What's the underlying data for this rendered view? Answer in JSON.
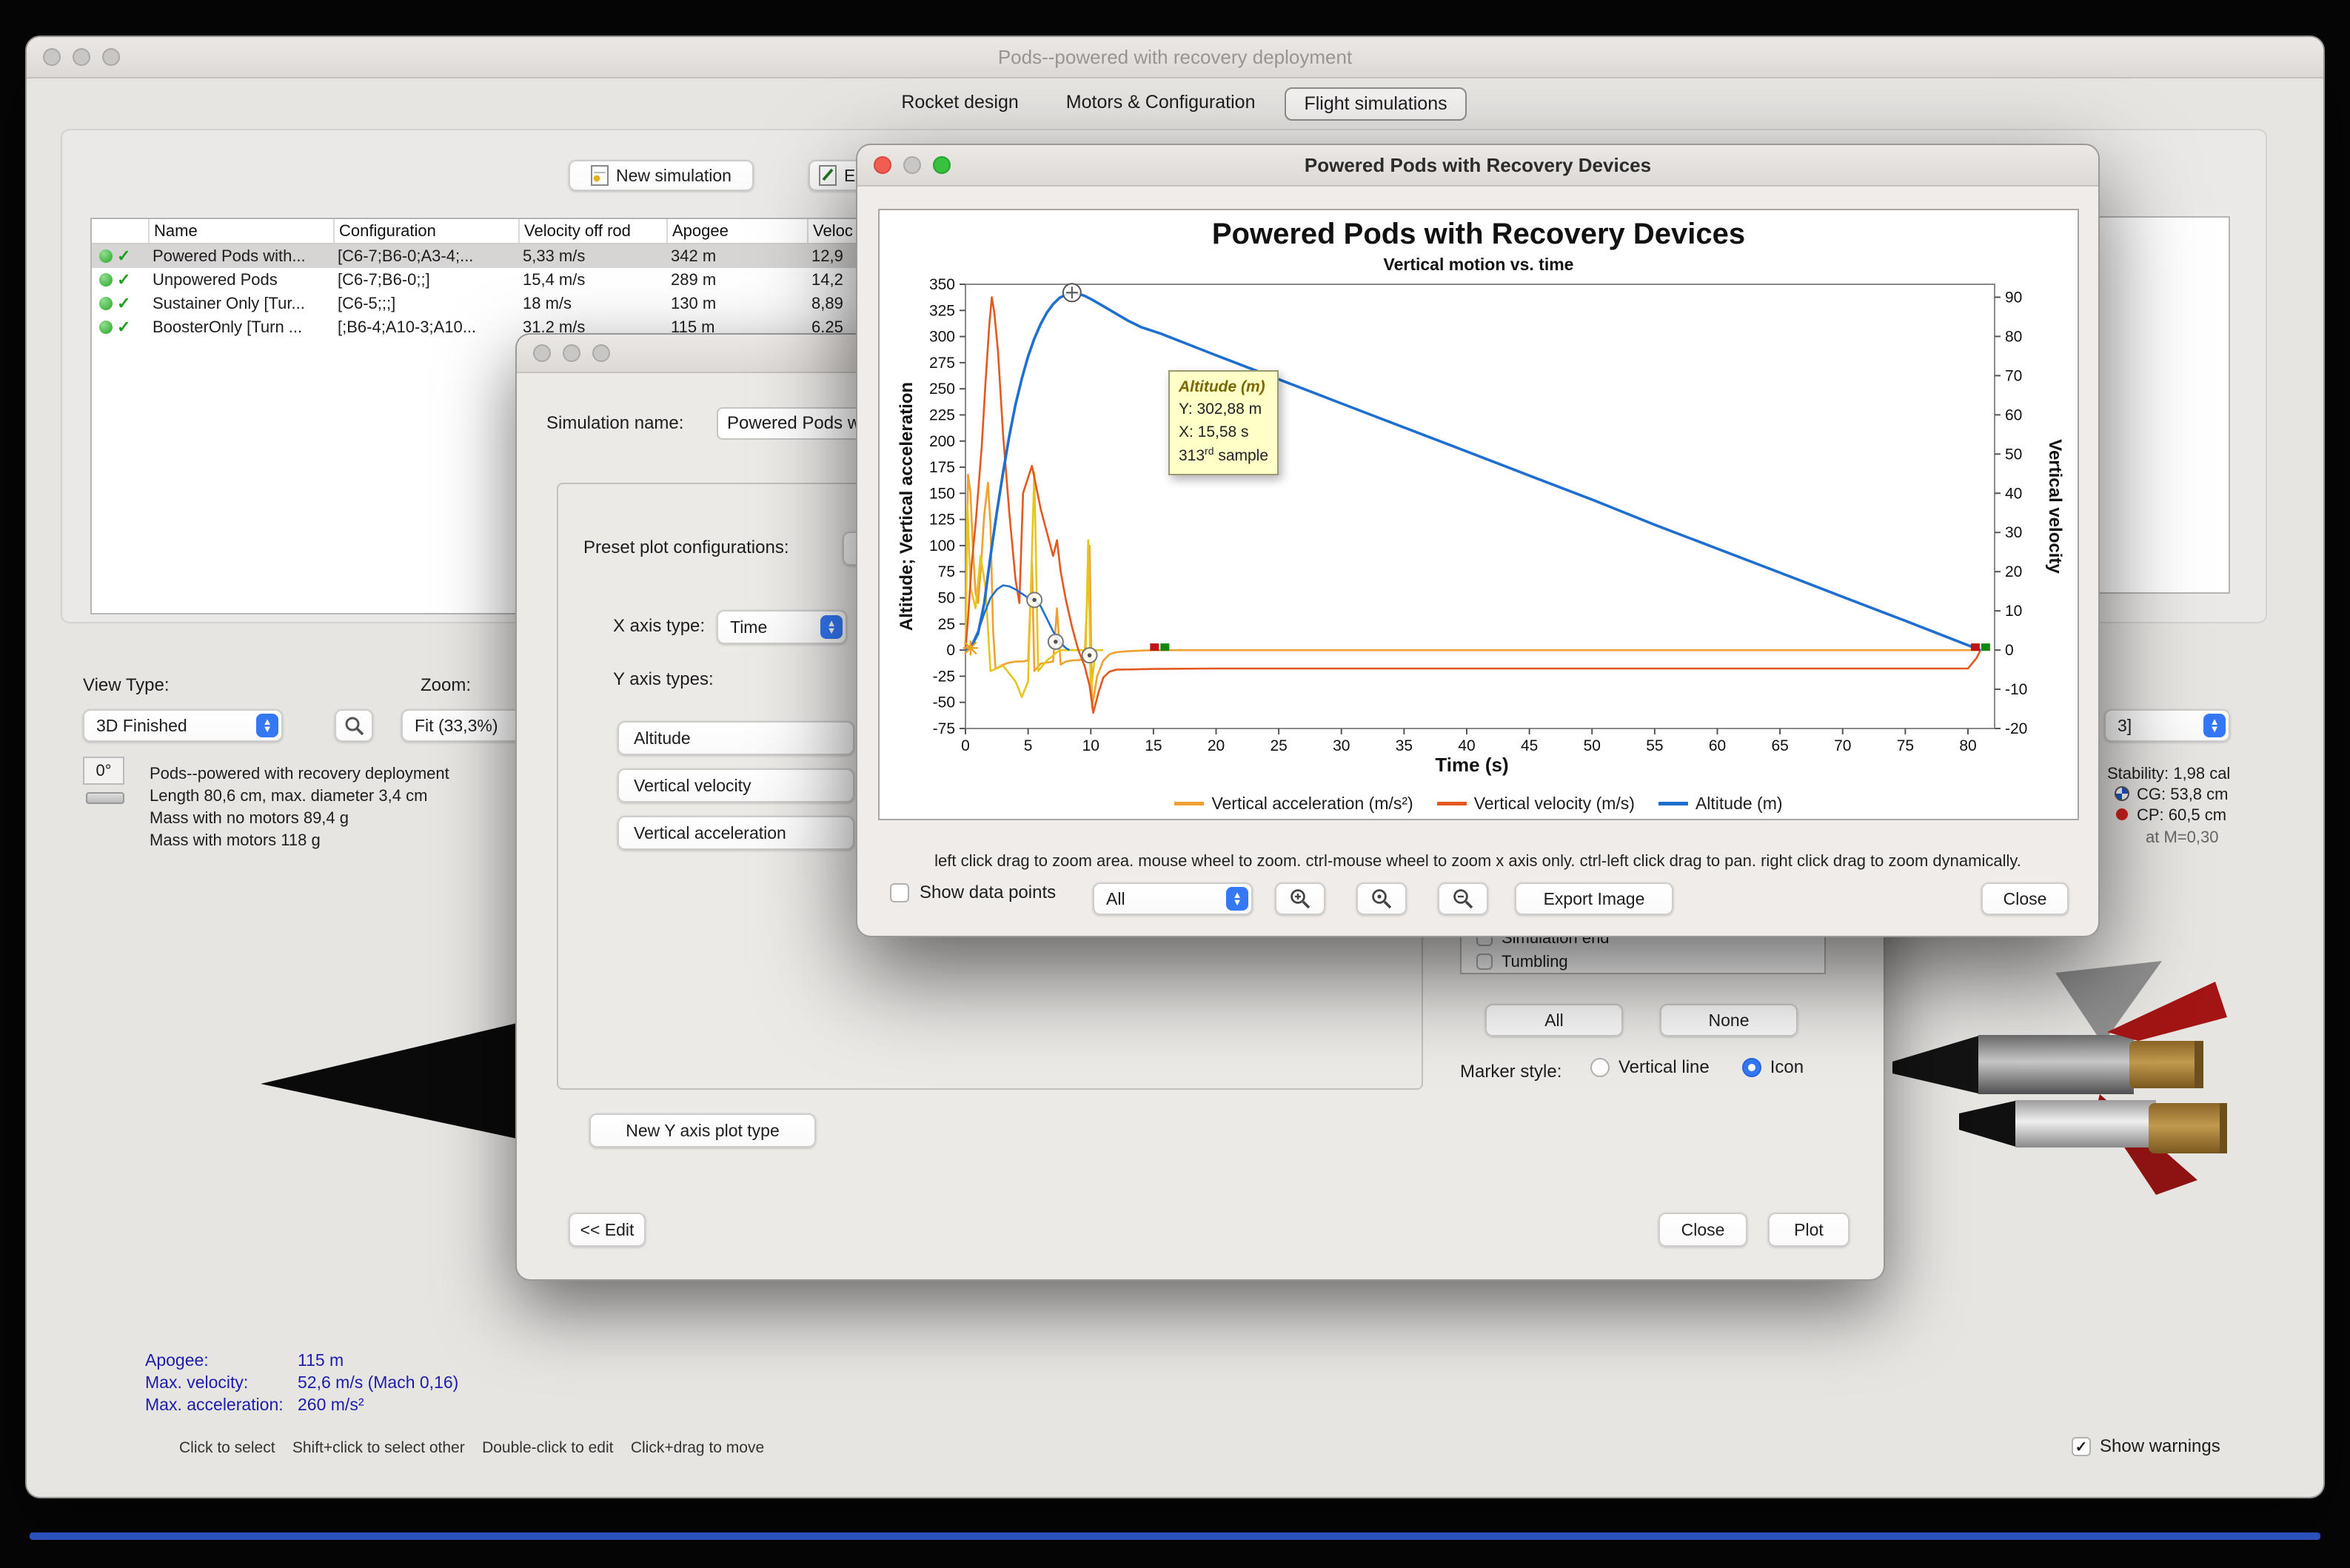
{
  "window": {
    "title": "Pods--powered with recovery deployment"
  },
  "tabs": [
    {
      "label": "Rocket design",
      "selected": false
    },
    {
      "label": "Motors & Configuration",
      "selected": false
    },
    {
      "label": "Flight simulations",
      "selected": true
    }
  ],
  "toolbar": {
    "new_simulation": "New simulation",
    "edit_partial": "E"
  },
  "sim_table": {
    "columns": [
      "Name",
      "Configuration",
      "Velocity off rod",
      "Apogee",
      "Veloc"
    ],
    "rows": [
      {
        "name": "Powered Pods with...",
        "config": "[C6-7;B6-0;A3-4;...",
        "vel_off_rod": "5,33 m/s",
        "apogee": "342 m",
        "vel": "12,9"
      },
      {
        "name": "Unpowered Pods",
        "config": "[C6-7;B6-0;;]",
        "vel_off_rod": "15,4 m/s",
        "apogee": "289 m",
        "vel": "14,2"
      },
      {
        "name": "Sustainer Only [Tur...",
        "config": "[C6-5;;;]",
        "vel_off_rod": "18 m/s",
        "apogee": "130 m",
        "vel": "8,89"
      },
      {
        "name": "BoosterOnly [Turn ...",
        "config": "[;B6-4;A10-3;A10...",
        "vel_off_rod": "31.2 m/s",
        "apogee": "115 m",
        "vel": "6.25"
      }
    ]
  },
  "view_controls": {
    "view_type_label": "View Type:",
    "view_type_value": "3D Finished",
    "zoom_label": "Zoom:",
    "zoom_value": "Fit (33,3%)",
    "angle": "0°",
    "config_selector": "3]"
  },
  "rocket_info": {
    "line1": "Pods--powered with recovery deployment",
    "line2": "Length 80,6 cm, max. diameter 3,4 cm",
    "line3": "Mass with no motors 89,4 g",
    "line4": "Mass with motors 118 g"
  },
  "stability": {
    "stability": "Stability: 1,98 cal",
    "cg": "CG: 53,8 cm",
    "cp": "CP: 60,5 cm",
    "mach": "at M=0,30"
  },
  "flight_stats": {
    "apogee_label": "Apogee:",
    "apogee": "115 m",
    "max_velocity_label": "Max. velocity:",
    "max_velocity": "52,6 m/s  (Mach 0,16)",
    "max_accel_label": "Max. acceleration:",
    "max_accel": "260 m/s²"
  },
  "hints": {
    "bar": "Click to select    Shift+click to select other    Double-click to edit    Click+drag to move",
    "show_warnings": "Show warnings"
  },
  "edit_dialog": {
    "sim_name_label": "Simulation name:",
    "sim_name_value": "Powered Pods with Recovery Devices",
    "preset_label": "Preset plot configurations:",
    "x_axis_label": "X axis type:",
    "x_axis_value": "Time",
    "y_axis_label": "Y axis types:",
    "y_types": [
      "Altitude",
      "Vertical velocity",
      "Vertical acceleration"
    ],
    "new_y_type": "New Y axis plot type",
    "events": [
      "Simulation end",
      "Tumbling"
    ],
    "all_btn": "All",
    "none_btn": "None",
    "marker_label": "Marker style:",
    "marker_options": [
      {
        "label": "Vertical line",
        "selected": false
      },
      {
        "label": "Icon",
        "selected": true
      }
    ],
    "edit_btn": "<< Edit",
    "close_btn": "Close",
    "plot_btn": "Plot"
  },
  "plot_dialog": {
    "title": "Powered Pods with Recovery Devices",
    "help": "left click drag to zoom area. mouse wheel to zoom. ctrl-mouse wheel to zoom x axis only. ctrl-left click drag to pan.  right click drag to zoom dynamically.",
    "show_points": "Show data points",
    "branch_dropdown": "All",
    "export": "Export Image",
    "close": "Close",
    "tooltip": {
      "title": "Altitude (m)",
      "y": "Y: 302,88 m",
      "x": "X: 15,58 s",
      "sample": "313",
      "sample_sup": "rd",
      "sample_suffix": " sample"
    }
  },
  "chart_data": {
    "type": "line",
    "title": "Powered Pods with Recovery Devices",
    "subtitle": "Vertical motion vs. time",
    "xlabel": "Time (s)",
    "ylabel_left": "Altitude; Vertical acceleration",
    "ylabel_right": "Vertical velocity",
    "xlim": [
      0,
      80
    ],
    "ylim_left": [
      -75,
      350
    ],
    "ylim_right": [
      -20,
      93.3
    ],
    "x_ticks": [
      0,
      5,
      10,
      15,
      20,
      25,
      30,
      35,
      40,
      45,
      50,
      55,
      60,
      65,
      70,
      75,
      80
    ],
    "left_ticks": [
      350,
      325,
      300,
      275,
      250,
      225,
      200,
      175,
      150,
      125,
      100,
      75,
      50,
      25,
      0,
      -25,
      -50,
      -75
    ],
    "right_ticks": [
      90,
      80,
      70,
      60,
      50,
      40,
      30,
      20,
      10,
      0,
      -10,
      -20
    ],
    "grid": false,
    "legend_position": "bottom",
    "series": [
      {
        "name": "Vertical acceleration (m/s²)",
        "color": "#f0a030",
        "axis": "left",
        "legend": true,
        "points": [
          [
            0,
            0
          ],
          [
            0.1,
            80
          ],
          [
            0.2,
            168
          ],
          [
            0.4,
            150
          ],
          [
            0.6,
            95
          ],
          [
            0.8,
            55
          ],
          [
            1,
            45
          ],
          [
            1.2,
            75
          ],
          [
            1.5,
            130
          ],
          [
            1.8,
            160
          ],
          [
            2,
            120
          ],
          [
            2.2,
            20
          ],
          [
            2.4,
            -18
          ],
          [
            3,
            -14
          ],
          [
            3.5,
            -12
          ],
          [
            4,
            -11
          ],
          [
            4.5,
            -11
          ],
          [
            5,
            -10
          ],
          [
            5.3,
            85
          ],
          [
            5.5,
            -20
          ],
          [
            6,
            -13
          ],
          [
            6.5,
            -12
          ],
          [
            7,
            -11
          ],
          [
            7.3,
            40
          ],
          [
            7.6,
            -14
          ],
          [
            8,
            -11
          ],
          [
            8.5,
            -10
          ],
          [
            9,
            -9.5
          ],
          [
            9.5,
            -9
          ],
          [
            9.9,
            100
          ],
          [
            10.1,
            -55
          ],
          [
            10.5,
            -25
          ],
          [
            11,
            -10
          ],
          [
            11.5,
            -4
          ],
          [
            12,
            -2
          ],
          [
            13,
            -1
          ],
          [
            15,
            0
          ],
          [
            20,
            0
          ],
          [
            30,
            0
          ],
          [
            40,
            0
          ],
          [
            50,
            0
          ],
          [
            60,
            0
          ],
          [
            70,
            0
          ],
          [
            80,
            0
          ],
          [
            81,
            0
          ]
        ]
      },
      {
        "name": "Vertical acceleration (booster branch)",
        "color": "#e6c51e",
        "axis": "left",
        "legend": false,
        "points": [
          [
            0,
            0
          ],
          [
            0.15,
            140
          ],
          [
            0.4,
            60
          ],
          [
            0.8,
            40
          ],
          [
            1.2,
            90
          ],
          [
            1.6,
            60
          ],
          [
            2,
            -20
          ],
          [
            3,
            -15
          ],
          [
            4,
            -30
          ],
          [
            4.5,
            -45
          ],
          [
            5,
            -30
          ],
          [
            5.5,
            170
          ],
          [
            5.8,
            -20
          ],
          [
            6.5,
            -10
          ],
          [
            7,
            -5
          ],
          [
            7.5,
            0
          ],
          [
            9.6,
            0
          ],
          [
            9.8,
            105
          ],
          [
            10,
            -40
          ],
          [
            10.4,
            0
          ],
          [
            11,
            0
          ]
        ]
      },
      {
        "name": "Vertical velocity (m/s)",
        "color": "#e2581f",
        "axis": "right",
        "legend": true,
        "points": [
          [
            0,
            0
          ],
          [
            0.2,
            8
          ],
          [
            0.5,
            22
          ],
          [
            0.8,
            32
          ],
          [
            1,
            40
          ],
          [
            1.3,
            52
          ],
          [
            1.6,
            68
          ],
          [
            1.9,
            83
          ],
          [
            2.1,
            90
          ],
          [
            2.3,
            86
          ],
          [
            2.6,
            76
          ],
          [
            3,
            55
          ],
          [
            3.5,
            35
          ],
          [
            4,
            18
          ],
          [
            4.3,
            12
          ],
          [
            4.6,
            40
          ],
          [
            5,
            44
          ],
          [
            5.3,
            47
          ],
          [
            6,
            36
          ],
          [
            6.5,
            30
          ],
          [
            7,
            24
          ],
          [
            7.3,
            28
          ],
          [
            7.6,
            20
          ],
          [
            8,
            13
          ],
          [
            8.5,
            6
          ],
          [
            9,
            0
          ],
          [
            9.5,
            -4
          ],
          [
            9.9,
            -9
          ],
          [
            10.2,
            -16
          ],
          [
            10.6,
            -11
          ],
          [
            11,
            -7
          ],
          [
            11.5,
            -5.5
          ],
          [
            12,
            -5
          ],
          [
            15,
            -4.8
          ],
          [
            20,
            -4.7
          ],
          [
            30,
            -4.7
          ],
          [
            40,
            -4.7
          ],
          [
            50,
            -4.7
          ],
          [
            60,
            -4.7
          ],
          [
            70,
            -4.7
          ],
          [
            80,
            -4.7
          ],
          [
            80.7,
            -2
          ],
          [
            81,
            0
          ]
        ]
      },
      {
        "name": "Altitude (booster branch)",
        "color": "#1f6fd0",
        "axis": "left",
        "legend": false,
        "points": [
          [
            0,
            0
          ],
          [
            0.5,
            5
          ],
          [
            1,
            18
          ],
          [
            1.5,
            35
          ],
          [
            2,
            50
          ],
          [
            2.5,
            58
          ],
          [
            3,
            62
          ],
          [
            3.5,
            61
          ],
          [
            4,
            58
          ],
          [
            4.5,
            54
          ],
          [
            5,
            50
          ],
          [
            5.5,
            48
          ],
          [
            6,
            42
          ],
          [
            6.5,
            30
          ],
          [
            7,
            18
          ],
          [
            7.5,
            8
          ],
          [
            8,
            2
          ],
          [
            8.3,
            0
          ]
        ]
      },
      {
        "name": "Altitude (m)",
        "color": "#1f6fd0",
        "axis": "left",
        "legend": true,
        "points": [
          [
            0,
            0
          ],
          [
            0.5,
            4
          ],
          [
            1,
            16
          ],
          [
            1.5,
            45
          ],
          [
            2,
            90
          ],
          [
            2.5,
            132
          ],
          [
            3,
            170
          ],
          [
            3.5,
            205
          ],
          [
            4,
            235
          ],
          [
            4.5,
            260
          ],
          [
            5,
            281
          ],
          [
            5.5,
            298
          ],
          [
            6,
            312
          ],
          [
            6.5,
            323
          ],
          [
            7,
            331
          ],
          [
            7.5,
            337
          ],
          [
            8,
            340
          ],
          [
            8.5,
            342
          ],
          [
            9,
            341
          ],
          [
            9.5,
            339
          ],
          [
            10,
            336
          ],
          [
            11,
            329
          ],
          [
            12,
            322
          ],
          [
            13,
            315
          ],
          [
            14,
            309
          ],
          [
            15.58,
            302.88
          ],
          [
            20,
            282
          ],
          [
            25,
            259
          ],
          [
            30,
            236
          ],
          [
            35,
            213
          ],
          [
            40,
            190
          ],
          [
            45,
            167
          ],
          [
            50,
            144
          ],
          [
            55,
            120
          ],
          [
            60,
            97
          ],
          [
            65,
            74
          ],
          [
            70,
            51
          ],
          [
            75,
            28
          ],
          [
            80,
            4.6
          ],
          [
            81,
            0
          ]
        ]
      }
    ],
    "markers": [
      {
        "x": 8.5,
        "y": 342,
        "axis": "left",
        "kind": "crosshair"
      },
      {
        "x": 5.5,
        "y": 48,
        "axis": "left",
        "kind": "event"
      },
      {
        "x": 7.2,
        "y": 8,
        "axis": "left",
        "kind": "event"
      },
      {
        "x": 9.9,
        "y": -5,
        "axis": "left",
        "kind": "event"
      },
      {
        "x": 0.4,
        "y": 2,
        "axis": "left",
        "kind": "launch"
      },
      {
        "x": 15.5,
        "y": 0,
        "axis": "left",
        "kind": "ground-flag"
      },
      {
        "x": 81,
        "y": 0,
        "axis": "left",
        "kind": "ground-flag"
      }
    ]
  }
}
